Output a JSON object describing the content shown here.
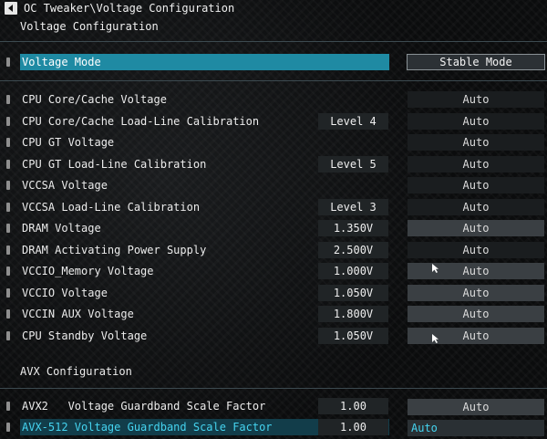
{
  "header": {
    "breadcrumb": "OC Tweaker\\Voltage Configuration",
    "title": "Voltage Configuration"
  },
  "voltage_mode": {
    "label": "Voltage Mode",
    "value": "Stable Mode"
  },
  "rows": [
    {
      "label": "CPU Core/Cache Voltage",
      "mid": "",
      "right": "Auto"
    },
    {
      "label": "CPU Core/Cache Load-Line Calibration",
      "mid": "Level 4",
      "right": "Auto"
    },
    {
      "label": "CPU GT Voltage",
      "mid": "",
      "right": "Auto"
    },
    {
      "label": "CPU GT Load-Line Calibration",
      "mid": "Level 5",
      "right": "Auto"
    },
    {
      "label": "VCCSA Voltage",
      "mid": "",
      "right": "Auto"
    },
    {
      "label": "VCCSA Load-Line Calibration",
      "mid": "Level 3",
      "right": "Auto"
    },
    {
      "label": "DRAM Voltage",
      "mid": "1.350V",
      "right": "Auto"
    },
    {
      "label": "DRAM Activating Power Supply",
      "mid": "2.500V",
      "right": "Auto"
    },
    {
      "label": "VCCIO_Memory Voltage",
      "mid": "1.000V",
      "right": "Auto"
    },
    {
      "label": "VCCIO Voltage",
      "mid": "1.050V",
      "right": "Auto"
    },
    {
      "label": "VCCIN AUX Voltage",
      "mid": "1.800V",
      "right": "Auto"
    },
    {
      "label": "CPU Standby Voltage",
      "mid": "1.050V",
      "right": "Auto"
    }
  ],
  "avx": {
    "section_title": "AVX Configuration",
    "rows": [
      {
        "label": "AVX2   Voltage Guardband Scale Factor",
        "mid": "1.00",
        "right": "Auto"
      },
      {
        "label": "AVX-512 Voltage Guardband Scale Factor",
        "mid": "1.00",
        "right": "Auto"
      }
    ]
  },
  "colors": {
    "accent": "#1f8aa3",
    "highlight_text": "#45d4f0",
    "background": "#0b0c0d"
  },
  "icons": {
    "back": "back-arrow-icon",
    "marker": "row-marker-icon",
    "cursor": "mouse-cursor-icon"
  }
}
